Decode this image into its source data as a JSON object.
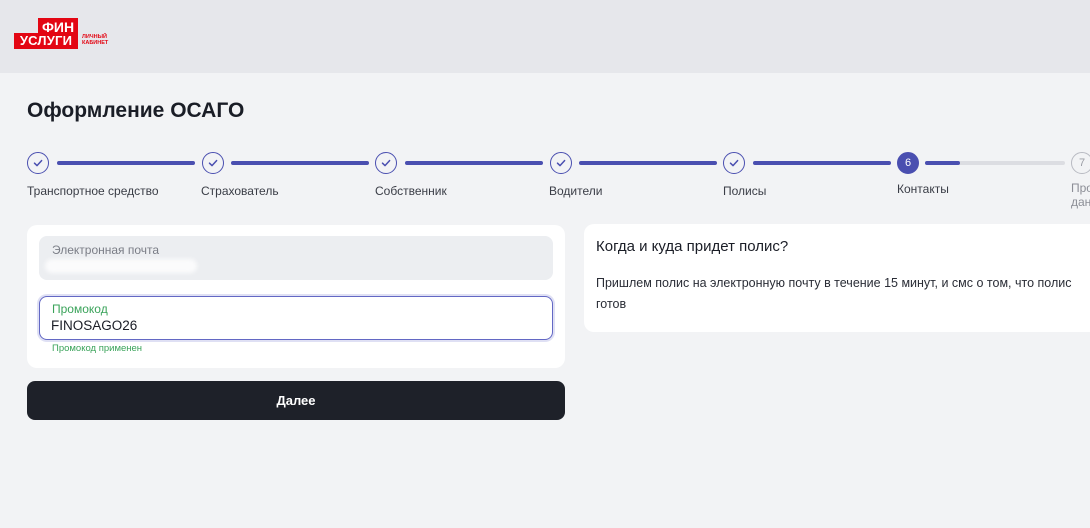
{
  "header": {
    "logo_top": "ФИН",
    "logo_bottom": "УСЛУГИ",
    "logo_sub_1": "ЛИЧНЫЙ",
    "logo_sub_2": "КАБИНЕТ"
  },
  "page_title": "Оформление ОСАГО",
  "steps": [
    {
      "label": "Транспортное средство",
      "status": "done"
    },
    {
      "label": "Страхователь",
      "status": "done"
    },
    {
      "label": "Собственник",
      "status": "done"
    },
    {
      "label": "Водители",
      "status": "done"
    },
    {
      "label": "Полисы",
      "status": "done"
    },
    {
      "number": "6",
      "label": "Контакты",
      "status": "active"
    },
    {
      "number": "7",
      "label": "Проверка данных",
      "status": "pending"
    }
  ],
  "form": {
    "email_label": "Электронная почта",
    "promo_label": "Промокод",
    "promo_value": "FINOSAGO26",
    "promo_status": "Промокод применен",
    "next_button": "Далее"
  },
  "info": {
    "title": "Когда и куда придет полис?",
    "text": "Пришлем полис на электронную почту в течение 15 минут, и смс о том, что полис готов"
  },
  "colors": {
    "brand_red": "#e30613",
    "accent": "#4a4fb0",
    "success": "#3aa35a",
    "button": "#1e2129"
  }
}
